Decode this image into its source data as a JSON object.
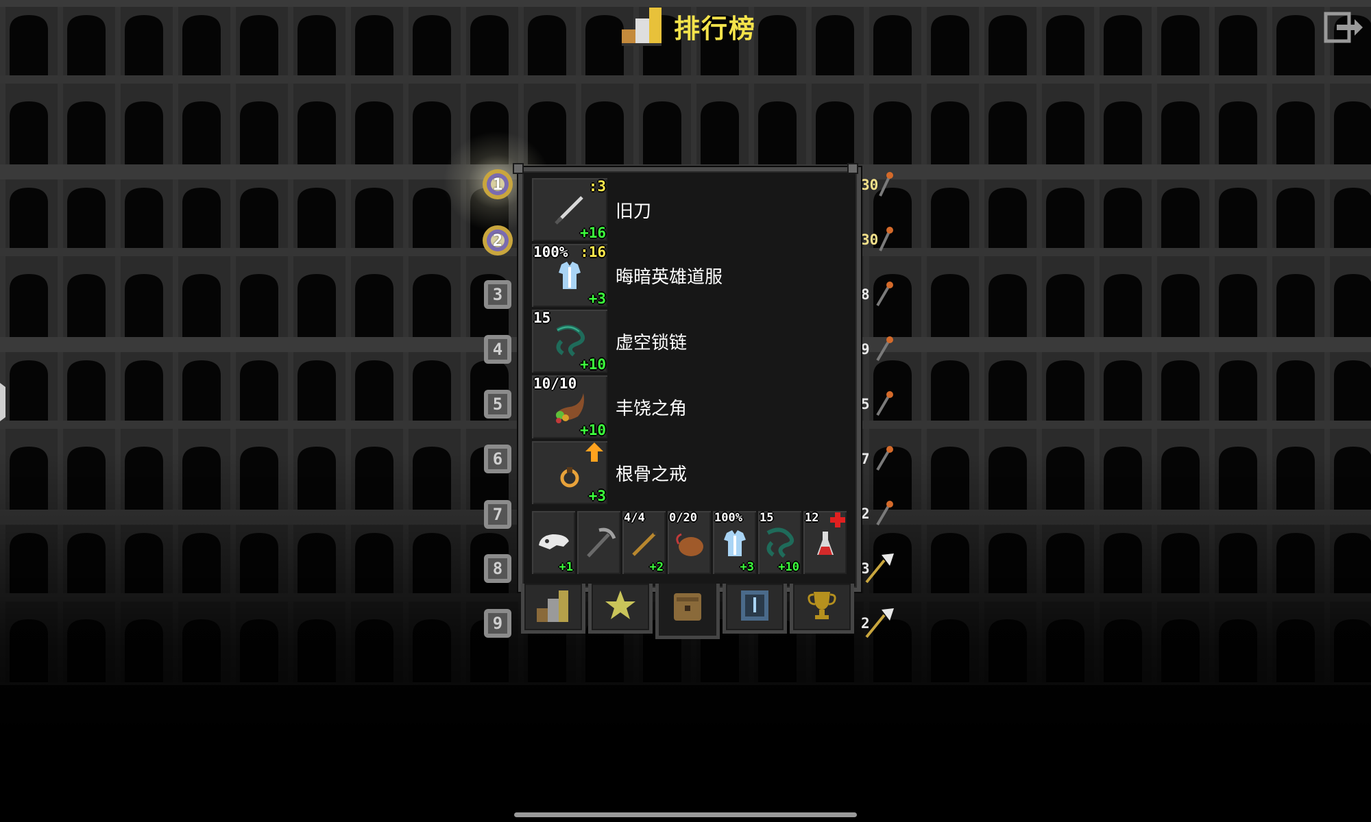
{
  "header": {
    "title": "排行榜",
    "exit_icon": "exit-icon"
  },
  "ranks": [
    "1",
    "2",
    "3",
    "4",
    "5",
    "6",
    "7",
    "8",
    "9"
  ],
  "scores": [
    "30",
    "30",
    "8",
    "9",
    "5",
    "7",
    "2",
    "3",
    "2"
  ],
  "items": [
    {
      "name": "旧刀",
      "top_left": "",
      "top_right": ":3",
      "bonus": "+16",
      "icon": "sword-icon"
    },
    {
      "name": "晦暗英雄道服",
      "top_left": "100%",
      "top_right": ":16",
      "bonus": "+3",
      "icon": "armor-icon"
    },
    {
      "name": "虚空锁链",
      "top_left": "15",
      "top_right": "",
      "bonus": "+10",
      "icon": "chains-icon"
    },
    {
      "name": "丰饶之角",
      "top_left": "10/10",
      "top_right": "",
      "bonus": "+10",
      "icon": "horn-icon"
    },
    {
      "name": "根骨之戒",
      "top_left": "",
      "top_right": "",
      "bonus": "+3",
      "icon": "ring-icon"
    }
  ],
  "quickslots": [
    {
      "top": "",
      "bonus": "+1",
      "icon": "skull-icon"
    },
    {
      "top": "",
      "bonus": "",
      "icon": "pickaxe-icon"
    },
    {
      "top": "4/4",
      "bonus": "+2",
      "icon": "wand-icon"
    },
    {
      "top": "0/20",
      "bonus": "",
      "icon": "bag-icon"
    },
    {
      "top": "100%",
      "bonus": "+3",
      "icon": "armor-icon"
    },
    {
      "top": "15",
      "bonus": "+10",
      "icon": "chains-icon"
    },
    {
      "top": "12",
      "bonus": "",
      "icon": "potion-icon"
    }
  ],
  "tabs": [
    "rankings-icon",
    "star-icon",
    "backpack-icon",
    "journal-icon",
    "trophy-icon"
  ],
  "colors": {
    "title": "#f4e34b",
    "bonus": "#3cff3c",
    "level": "#ffe94c"
  }
}
